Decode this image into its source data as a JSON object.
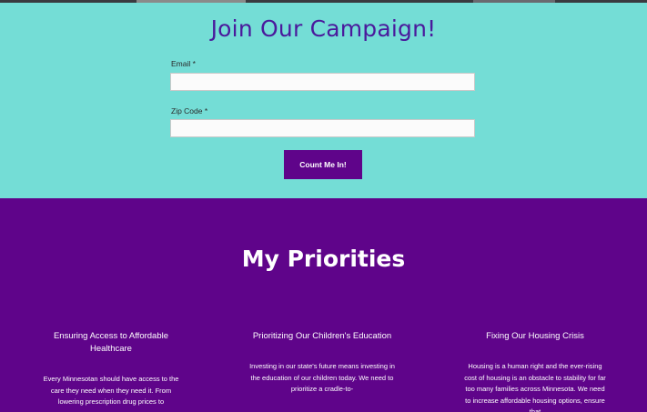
{
  "signup": {
    "title": "Join Our Campaign!",
    "email_label": "Email *",
    "email_value": "",
    "zip_label": "Zip Code *",
    "zip_value": "",
    "submit_label": "Count Me In!"
  },
  "priorities": {
    "title": "My Priorities",
    "items": [
      {
        "heading": "Ensuring Access to Affordable Healthcare",
        "body": "Every Minnesotan should have access to the care they need when they need it. From lowering prescription drug prices to"
      },
      {
        "heading": "Prioritizing Our Children's Education",
        "body": "Investing in our state's future means investing in the education of our children today. We need to prioritize a cradle-to-"
      },
      {
        "heading": "Fixing Our Housing Crisis",
        "body": "Housing is a human right and the ever-rising cost of housing is an obstacle to stability for far too many families across Minnesota. We need to increase affordable housing options, ensure that"
      }
    ]
  },
  "colors": {
    "signup_bg": "#74ddd6",
    "priorities_bg": "#5f048a",
    "title_purple": "#4a1a9c",
    "button_bg": "#5f048a"
  }
}
